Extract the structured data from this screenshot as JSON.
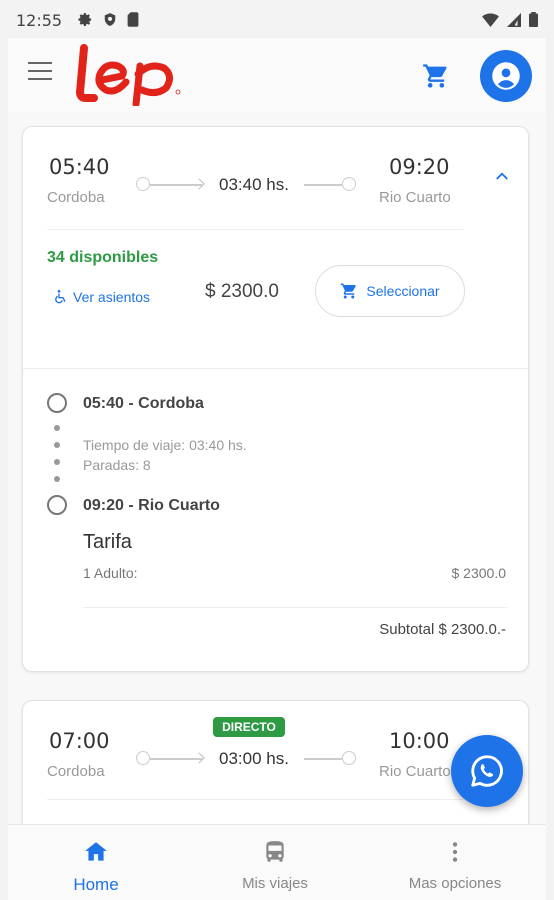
{
  "status_bar": {
    "time": "12:55"
  },
  "app": {
    "logo_text": "lep"
  },
  "trips": [
    {
      "depart_time": "05:40",
      "depart_city": "Cordoba",
      "duration": "03:40 hs.",
      "arrive_time": "09:20",
      "arrive_city": "Rio Cuarto",
      "available": "34 disponibles",
      "seats_link": "Ver asientos",
      "price": "$ 2300.0",
      "select_label": "Seleccionar",
      "stops": {
        "origin": "05:40 - Cordoba",
        "travel_time": "Tiempo de viaje: 03:40 hs.",
        "stops_count": "Paradas: 8",
        "destination": "09:20 - Rio Cuarto"
      },
      "fare": {
        "title": "Tarifa",
        "label": "1 Adulto:",
        "value": "$ 2300.0",
        "subtotal": "Subtotal $ 2300.0.-"
      }
    },
    {
      "badge": "DIRECTO",
      "depart_time": "07:00",
      "depart_city": "Cordoba",
      "duration": "03:00 hs.",
      "arrive_time": "10:00",
      "arrive_city": "Rio Cuarto"
    }
  ],
  "bottom_nav": {
    "items": [
      {
        "label": "Home",
        "icon": "home-icon",
        "active": true
      },
      {
        "label": "Mis viajes",
        "icon": "bus-icon",
        "active": false
      },
      {
        "label": "Mas opciones",
        "icon": "more-vert-icon",
        "active": false
      }
    ]
  },
  "colors": {
    "primary": "#1e73e8",
    "success": "#2e9a43",
    "brand": "#e2231a"
  }
}
